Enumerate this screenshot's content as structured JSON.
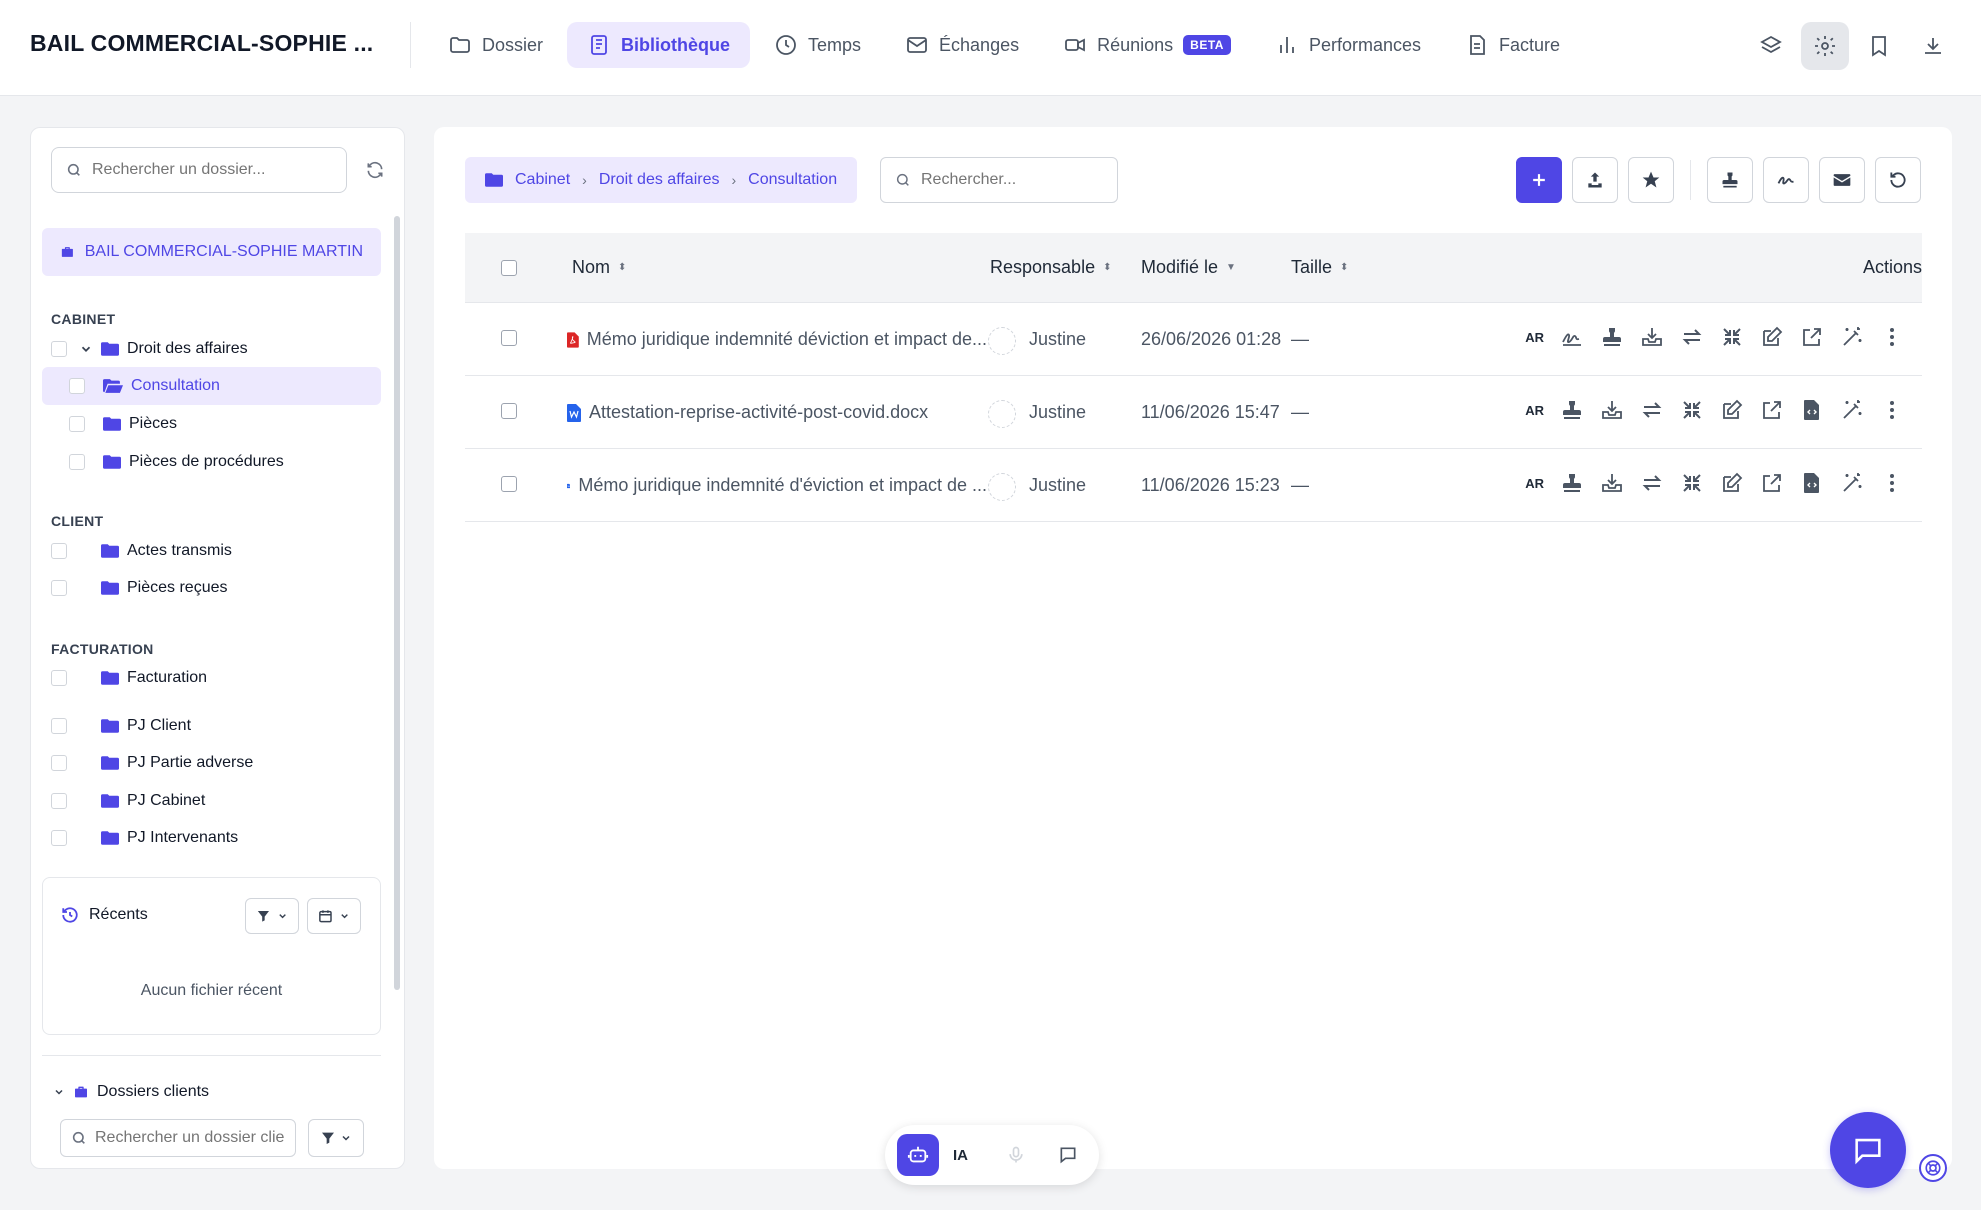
{
  "app_title": "BAIL COMMERCIAL-SOPHIE ...",
  "nav": [
    {
      "label": "Dossier",
      "icon": "folder-icon"
    },
    {
      "label": "Bibliothèque",
      "icon": "book-icon",
      "active": true
    },
    {
      "label": "Temps",
      "icon": "clock-icon"
    },
    {
      "label": "Échanges",
      "icon": "mail-icon"
    },
    {
      "label": "Réunions",
      "icon": "video-icon",
      "badge": "BETA"
    },
    {
      "label": "Performances",
      "icon": "bar-chart-icon"
    },
    {
      "label": "Facture",
      "icon": "document-icon"
    }
  ],
  "top_actions": [
    "layers-icon",
    "gear-icon",
    "bookmark-icon",
    "download-icon"
  ],
  "sidebar": {
    "search_placeholder": "Rechercher un dossier...",
    "case_title": "BAIL COMMERCIAL-SOPHIE MARTIN",
    "sections": [
      {
        "label": "CABINET"
      },
      {
        "label": "CLIENT"
      },
      {
        "label": "FACTURATION"
      }
    ],
    "tree": {
      "droit": "Droit des affaires",
      "consultation": "Consultation",
      "pieces": "Pièces",
      "procedures": "Pièces de procédures",
      "actes": "Actes transmis",
      "recues": "Pièces reçues",
      "facturation": "Facturation",
      "pj_client": "PJ Client",
      "pj_adverse": "PJ Partie adverse",
      "pj_cabinet": "PJ Cabinet",
      "pj_intervenants": "PJ Intervenants"
    },
    "recents_title": "Récents",
    "recents_empty": "Aucun fichier récent",
    "clients_title": "Dossiers clients",
    "clients_search_placeholder": "Rechercher un dossier client"
  },
  "main": {
    "breadcrumb": [
      "Cabinet",
      "Droit des affaires",
      "Consultation"
    ],
    "search_placeholder": "Rechercher...",
    "columns": {
      "name": "Nom",
      "owner": "Responsable",
      "modified": "Modifié le",
      "size": "Taille",
      "actions": "Actions"
    },
    "files": [
      {
        "name": "Mémo juridique indemnité déviction et impact de...",
        "type": "pdf",
        "owner": "Justine",
        "modified": "26/06/2026 01:28",
        "size": "—",
        "ar": "AR"
      },
      {
        "name": "Attestation-reprise-activité-post-covid.docx",
        "type": "word",
        "owner": "Justine",
        "modified": "11/06/2026 15:47",
        "size": "—",
        "ar": "AR"
      },
      {
        "name": "Mémo juridique indemnité d'éviction et impact de ...",
        "type": "word",
        "owner": "Justine",
        "modified": "11/06/2026 15:23",
        "size": "—",
        "ar": "AR"
      }
    ]
  },
  "ai_bar": {
    "label": "IA"
  },
  "colors": {
    "accent": "#4f46e5",
    "accent_light": "#ede9fe",
    "pdf": "#dc2626",
    "word": "#2563eb"
  }
}
